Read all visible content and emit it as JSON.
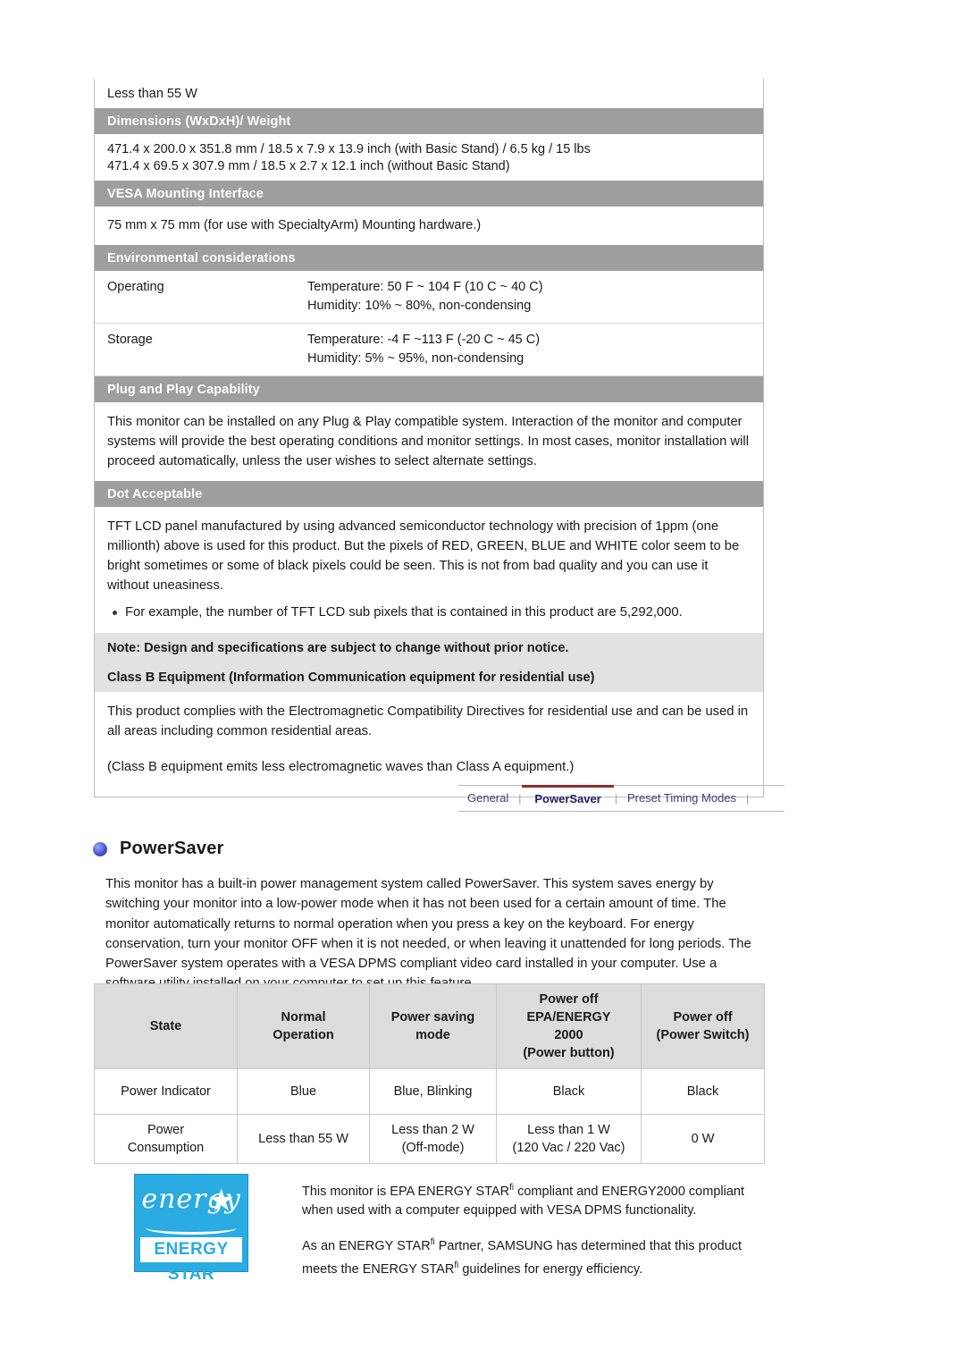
{
  "spec": {
    "power_less": "Less than 55 W",
    "dimensions_header": "Dimensions (WxDxH)/ Weight",
    "dimensions_line1": "471.4 x 200.0 x 351.8 mm / 18.5 x 7.9 x 13.9 inch (with Basic Stand) / 6.5 kg / 15 lbs",
    "dimensions_line2": "471.4 x 69.5 x 307.9 mm / 18.5 x 2.7 x 12.1 inch (without Basic Stand)",
    "vesa_header": "VESA Mounting Interface",
    "vesa_text": "75 mm x 75 mm (for use with SpecialtyArm) Mounting hardware.)",
    "env_header": "Environmental considerations",
    "env_rows": [
      {
        "label": "Operating",
        "line1": "Temperature: 50  F ~ 104  F (10  C ~ 40  C)",
        "line2": "Humidity: 10% ~ 80%, non-condensing"
      },
      {
        "label": "Storage",
        "line1": "Temperature: -4  F ~113  F (-20  C ~ 45  C)",
        "line2": "Humidity: 5% ~ 95%, non-condensing"
      }
    ],
    "pnp_header": "Plug and Play Capability",
    "pnp_text": "This monitor can be installed on any Plug & Play compatible system. Interaction of the monitor and computer systems will provide the best operating conditions and monitor settings. In most cases, monitor installation will proceed automatically, unless the user wishes to select alternate settings.",
    "dot_header": "Dot Acceptable",
    "dot_text": "TFT LCD panel manufactured by using advanced semiconductor technology with precision of 1ppm (one millionth) above is used for this product. But the pixels of RED, GREEN, BLUE and WHITE color seem to be bright sometimes or some of black pixels could be seen. This is not from bad quality and you can use it without uneasiness.",
    "dot_bullet": "For example, the number of TFT LCD sub pixels that is contained in this product are 5,292,000.",
    "note_header": "Note: Design and specifications are subject to change without prior notice.",
    "classb_header": "Class B Equipment (Information Communication equipment for residential use)",
    "classb_text1": "This product complies with the Electromagnetic Compatibility Directives for residential use and can be used in all areas including common residential areas.",
    "classb_text2": "(Class B equipment emits less electromagnetic waves than Class A equipment.)"
  },
  "tabs": {
    "general": "General",
    "powersaver": "PowerSaver",
    "preset": "Preset Timing Modes",
    "sep": "|"
  },
  "powersaver": {
    "title": "PowerSaver",
    "paragraph": "This monitor has a built-in power management system called PowerSaver. This system saves energy by switching your monitor into a low-power mode when it has not been used for a certain amount of time. The monitor automatically returns to normal operation when you press a key on the keyboard. For energy conservation, turn your monitor OFF when it is not needed, or when leaving it unattended for long periods. The PowerSaver system operates with a VESA DPMS compliant video card installed in your computer. Use a software utility installed on your computer to set up this feature.",
    "table": {
      "headers": [
        {
          "line1": "State",
          "line2": "",
          "line3": "",
          "line4": ""
        },
        {
          "line1": "Normal",
          "line2": "Operation",
          "line3": "",
          "line4": ""
        },
        {
          "line1": "Power saving",
          "line2": "mode",
          "line3": "",
          "line4": ""
        },
        {
          "line1": "Power off",
          "line2": "EPA/ENERGY",
          "line3": "2000",
          "line4": "(Power button)"
        },
        {
          "line1": "Power off",
          "line2": "(Power Switch)",
          "line3": "",
          "line4": ""
        }
      ],
      "rows": [
        {
          "label_line1": "Power Indicator",
          "label_line2": "",
          "cells": [
            {
              "line1": "Blue",
              "line2": ""
            },
            {
              "line1": "Blue, Blinking",
              "line2": ""
            },
            {
              "line1": "Black",
              "line2": ""
            },
            {
              "line1": "Black",
              "line2": ""
            }
          ]
        },
        {
          "label_line1": "Power",
          "label_line2": "Consumption",
          "cells": [
            {
              "line1": "Less than 55 W",
              "line2": ""
            },
            {
              "line1": "Less than 2 W",
              "line2": "(Off-mode)"
            },
            {
              "line1": "Less than 1 W",
              "line2": "(120 Vac / 220 Vac)"
            },
            {
              "line1": "0 W",
              "line2": ""
            }
          ]
        }
      ]
    }
  },
  "energy_star": {
    "logo_word": "energy",
    "logo_bar": "ENERGY STAR",
    "text1_a": "This monitor is EPA ENERGY STAR",
    "text1_sup": "fi",
    "text1_b": " compliant and ENERGY2000 compliant when used with a computer equipped with VESA DPMS functionality.",
    "text2_a": "As an ENERGY STAR",
    "text2_sup": "fi",
    "text2_b": " Partner, SAMSUNG has determined that this product meets the ENERGY STAR",
    "text2_sup2": "fi",
    "text2_c": " guidelines for energy efficiency."
  }
}
